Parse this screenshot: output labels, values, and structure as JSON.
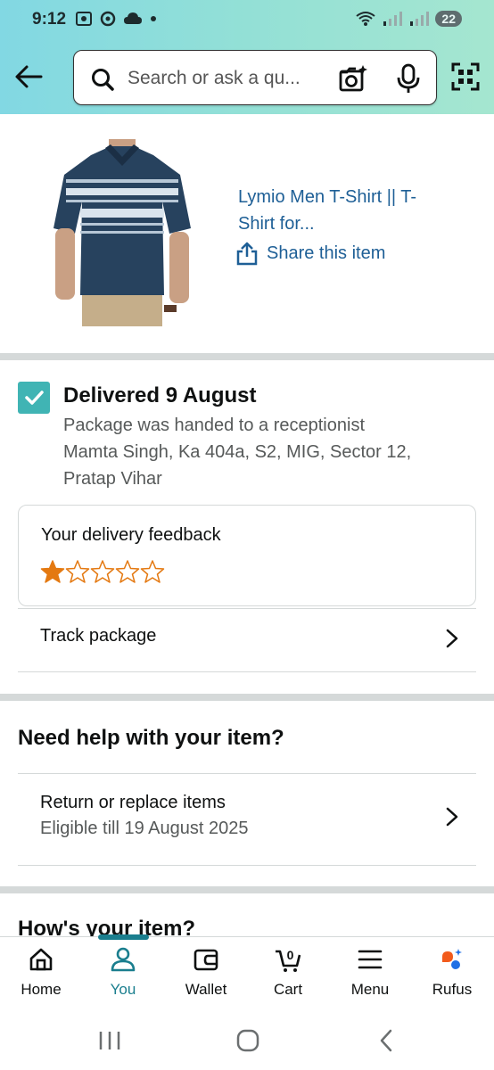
{
  "status_bar": {
    "time": "9:12",
    "battery": "22"
  },
  "search": {
    "placeholder": "Search or ask a qu..."
  },
  "product": {
    "title_line1": "Lymio Men T-Shirt || T-",
    "title_line2": "Shirt for...",
    "share_label": "Share this item"
  },
  "delivery": {
    "title": "Delivered 9 August",
    "note_line1": "Package was handed to a receptionist",
    "note_line2": "Mamta Singh, Ka 404a, S2, MIG, Sector 12,",
    "note_line3": "Pratap Vihar",
    "feedback_title": "Your delivery feedback",
    "rating": 1,
    "rating_max": 5,
    "track_label": "Track package"
  },
  "help": {
    "title": "Need help with your item?",
    "return_label": "Return or replace items",
    "return_sub": "Eligible till 19 August 2025"
  },
  "hows_item": {
    "title": "How's your item?"
  },
  "bottom_nav": {
    "items": [
      {
        "label": "Home",
        "icon": "home-icon"
      },
      {
        "label": "You",
        "icon": "person-icon",
        "active": true
      },
      {
        "label": "Wallet",
        "icon": "wallet-icon"
      },
      {
        "label": "Cart",
        "icon": "cart-icon",
        "badge": "0"
      },
      {
        "label": "Menu",
        "icon": "menu-icon"
      },
      {
        "label": "Rufus",
        "icon": "rufus-icon"
      }
    ]
  },
  "colors": {
    "link": "#1e5f96",
    "accent": "#1a7e8e",
    "check": "#40b4b4",
    "star": "#e47911"
  }
}
